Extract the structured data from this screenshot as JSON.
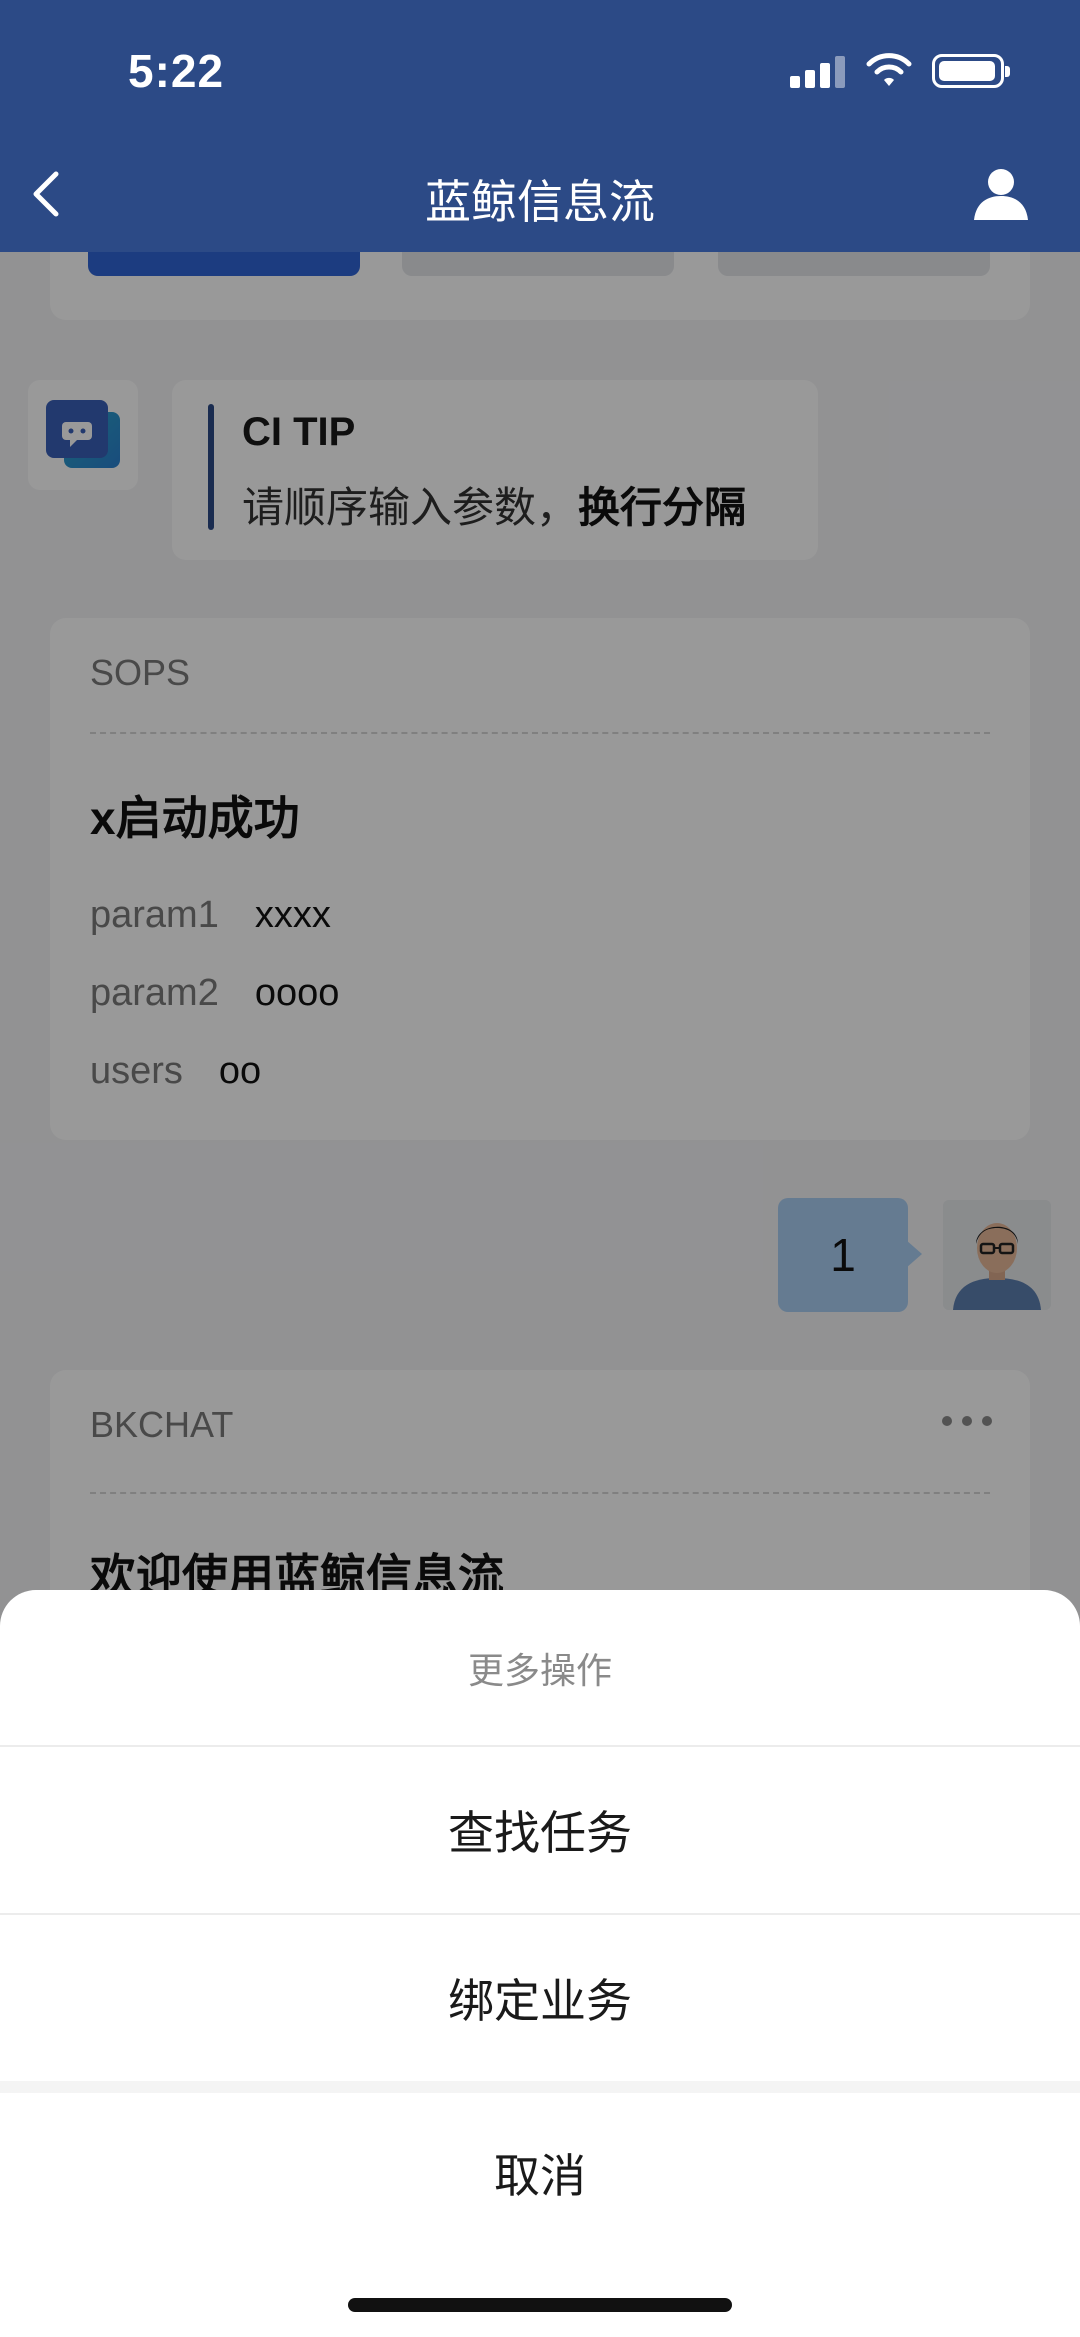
{
  "status_bar": {
    "time": "5:22"
  },
  "nav": {
    "title": "蓝鲸信息流"
  },
  "tip_card": {
    "title": "CI TIP",
    "text_prefix": "请顺序输入参数，",
    "text_bold": "换行分隔"
  },
  "sops_card": {
    "source": "SOPS",
    "heading": "x启动成功",
    "params": [
      {
        "key": "param1",
        "value": "xxxx"
      },
      {
        "key": "param2",
        "value": "oooo"
      },
      {
        "key": "users",
        "value": "oo"
      }
    ]
  },
  "user_message": {
    "text": "1"
  },
  "bkchat_card": {
    "source": "BKCHAT",
    "heading": "欢迎使用蓝鲸信息流"
  },
  "action_sheet": {
    "title": "更多操作",
    "items": [
      "查找任务",
      "绑定业务"
    ],
    "cancel_label": "取消"
  },
  "colors": {
    "header": "#2c4a86",
    "primary": "#2f64d6",
    "user_bubble": "#a9cdf2",
    "overlay": "rgba(0,0,0,0.40)"
  },
  "icons": [
    "back-icon",
    "profile-icon",
    "signal-icon",
    "wifi-icon",
    "battery-icon",
    "more-icon"
  ]
}
